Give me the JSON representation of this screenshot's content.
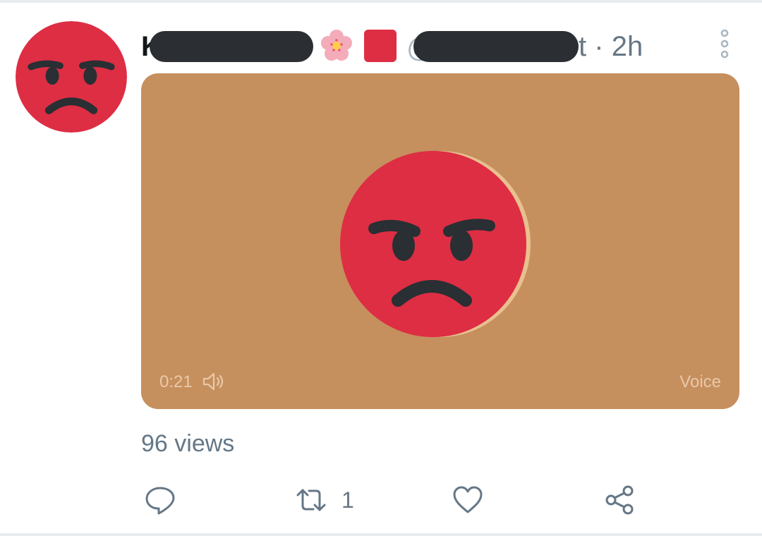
{
  "tweet": {
    "author": {
      "name_visible_start": "K",
      "handle_visible_start": "@",
      "handle_visible_end": "t",
      "badges": [
        "cherry-blossom-icon",
        "red-square-icon"
      ]
    },
    "time_separator": "·",
    "time": "2h",
    "media": {
      "duration": "0:21",
      "type_label": "Voice",
      "background_color": "#c68f5e",
      "face_color": "#dd2e44"
    },
    "views": "96 views",
    "actions": {
      "reply": {
        "icon": "reply-icon",
        "count": ""
      },
      "retweet": {
        "icon": "retweet-icon",
        "count": "1"
      },
      "like": {
        "icon": "heart-icon",
        "count": ""
      },
      "share": {
        "icon": "share-icon",
        "count": ""
      }
    }
  },
  "colors": {
    "secondary_text": "#657786",
    "primary_text": "#14171a",
    "divider": "#e6ecf0",
    "redaction": "#2b2f33"
  }
}
